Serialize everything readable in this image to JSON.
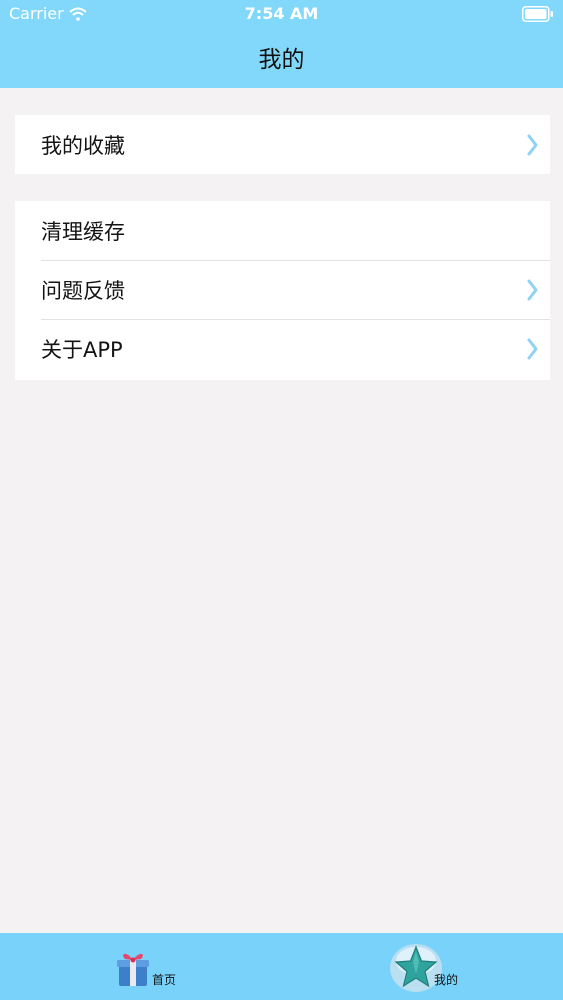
{
  "status_bar": {
    "carrier": "Carrier",
    "time": "7:54 AM",
    "wifi_icon": "wifi-icon",
    "battery_icon": "battery-icon"
  },
  "nav": {
    "title": "我的"
  },
  "groups": [
    {
      "rows": [
        {
          "label": "我的收藏",
          "has_chevron": true
        }
      ]
    },
    {
      "rows": [
        {
          "label": "清理缓存",
          "has_chevron": false
        },
        {
          "label": "问题反馈",
          "has_chevron": true
        },
        {
          "label": "关于APP",
          "has_chevron": true
        }
      ]
    }
  ],
  "tabbar": {
    "tabs": [
      {
        "label": "首页",
        "icon": "gift-icon",
        "selected": false
      },
      {
        "label": "我的",
        "icon": "star-icon",
        "selected": true
      }
    ]
  },
  "colors": {
    "bar_background": "#82d8fb",
    "tabbar_background": "#79d2fa",
    "page_background": "#f4f2f2",
    "chevron": "#8fd2f5"
  }
}
